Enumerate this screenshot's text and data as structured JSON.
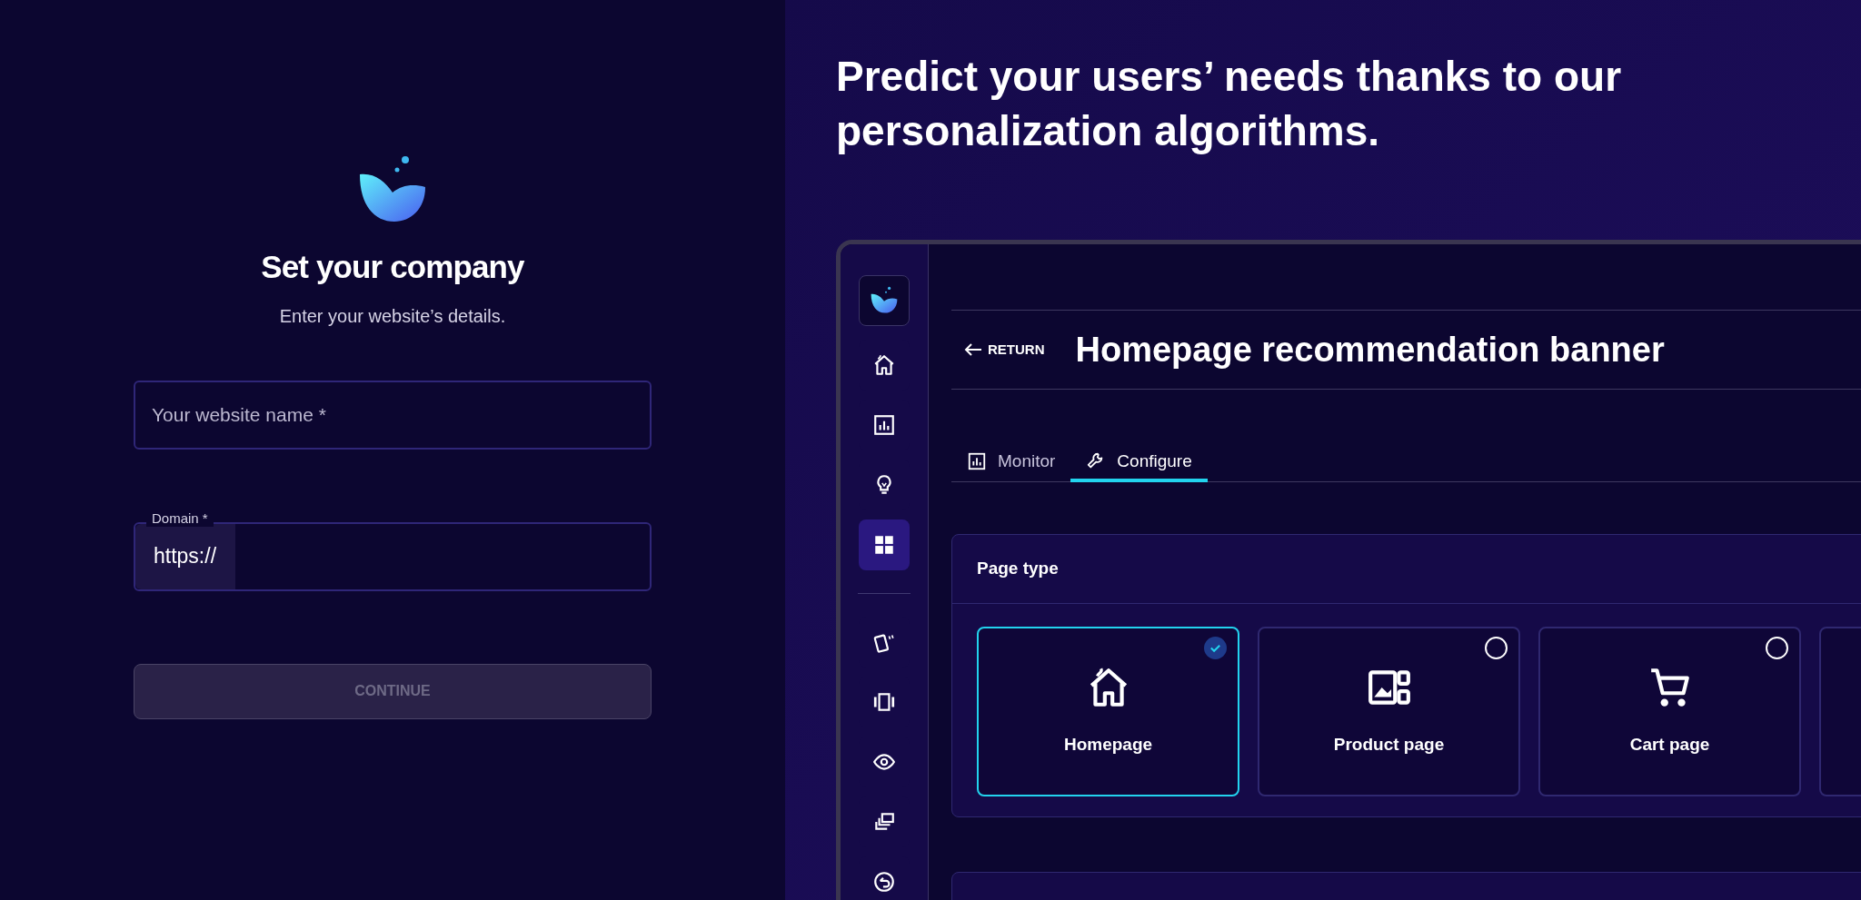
{
  "signup": {
    "title": "Set your company",
    "subtitle": "Enter your website’s details.",
    "fields": [
      {
        "kind": "plain",
        "placeholder": "Your website name *"
      },
      {
        "kind": "prefixed",
        "label": "Domain *",
        "prefix": "https://"
      }
    ],
    "button": {
      "label": "CONTINUE",
      "disabled": true
    }
  },
  "promo": {
    "headline": "Predict your users’ needs thanks to our personalization algorithms."
  },
  "app": {
    "sidebar": {
      "items": [
        {
          "kind": "home",
          "selected": false
        },
        {
          "kind": "chart",
          "selected": false
        },
        {
          "kind": "bulb",
          "selected": false
        },
        {
          "kind": "grid",
          "selected": true
        },
        {
          "kind": "divider"
        },
        {
          "kind": "cards",
          "selected": false
        },
        {
          "kind": "carousel",
          "selected": false
        },
        {
          "kind": "eye",
          "selected": false
        },
        {
          "kind": "copy",
          "selected": false
        },
        {
          "kind": "undo",
          "selected": false
        }
      ]
    },
    "return_link": "RETURN",
    "title": "Homepage recommendation banner",
    "tabs": [
      {
        "label": "Monitor",
        "kind": "chart",
        "selected": false
      },
      {
        "label": "Configure",
        "kind": "wrench",
        "selected": true
      }
    ],
    "page_type": {
      "title": "Page type",
      "options": [
        {
          "label": "Homepage",
          "kind": "home",
          "selected": true
        },
        {
          "label": "Product page",
          "kind": "product",
          "selected": false
        },
        {
          "label": "Cart page",
          "kind": "cart",
          "selected": false
        }
      ]
    }
  }
}
